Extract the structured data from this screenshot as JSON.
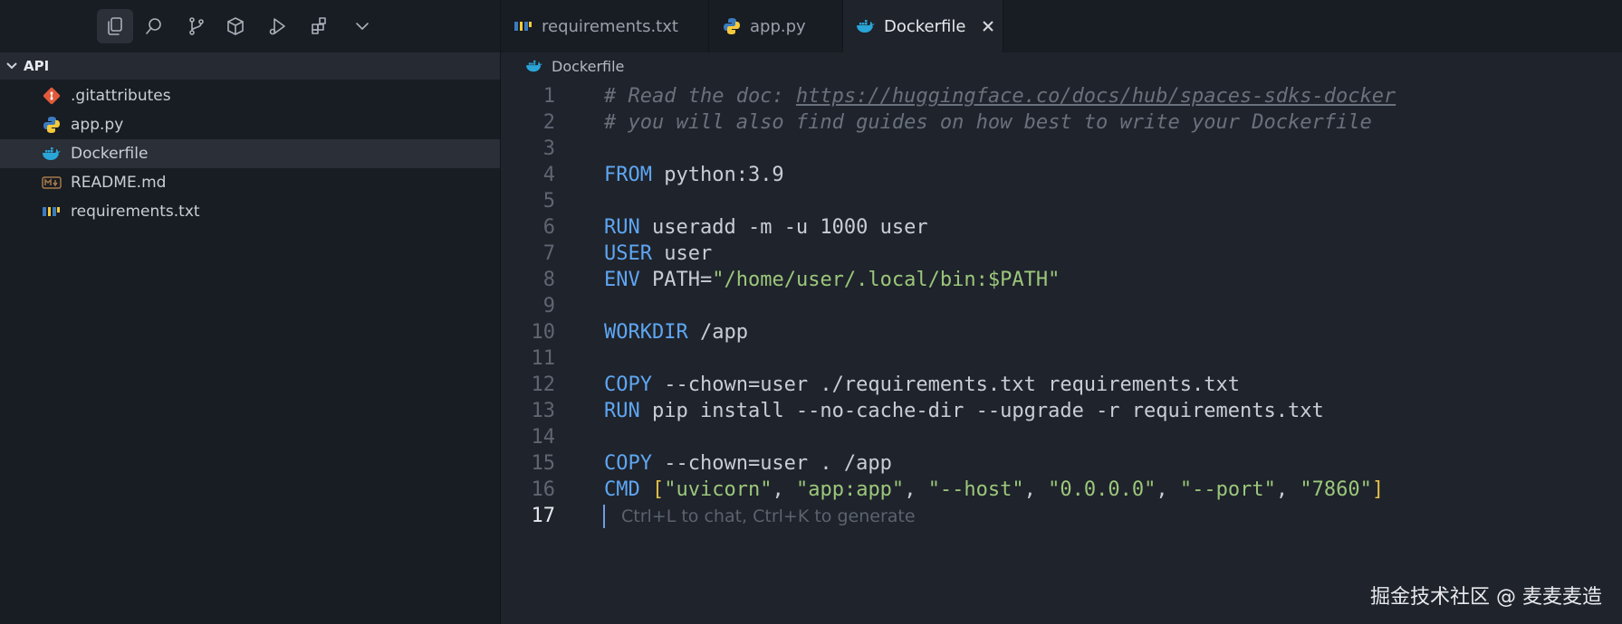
{
  "sidebar": {
    "folder": "API",
    "files": [
      {
        "name": ".gitattributes",
        "icon": "git-icon"
      },
      {
        "name": "app.py",
        "icon": "python-icon"
      },
      {
        "name": "Dockerfile",
        "icon": "docker-icon"
      },
      {
        "name": "README.md",
        "icon": "markdown-icon"
      },
      {
        "name": "requirements.txt",
        "icon": "pip-icon"
      }
    ]
  },
  "tabs": [
    {
      "label": "requirements.txt",
      "icon": "pip-icon"
    },
    {
      "label": "app.py",
      "icon": "python-icon"
    },
    {
      "label": "Dockerfile",
      "icon": "docker-icon"
    }
  ],
  "breadcrumb": "Dockerfile",
  "lines": [
    {
      "n": "1",
      "parts": [
        {
          "t": "# Read the doc: ",
          "c": "cm"
        },
        {
          "t": "https://huggingface.co/docs/hub/spaces-sdks-docker",
          "c": "cm url"
        }
      ]
    },
    {
      "n": "2",
      "parts": [
        {
          "t": "# you will also find guides on how best to write your Dockerfile",
          "c": "cm"
        }
      ]
    },
    {
      "n": "3",
      "parts": []
    },
    {
      "n": "4",
      "parts": [
        {
          "t": "FROM",
          "c": "kw"
        },
        {
          "t": " python:3.9",
          "c": "tx"
        }
      ]
    },
    {
      "n": "5",
      "parts": []
    },
    {
      "n": "6",
      "parts": [
        {
          "t": "RUN",
          "c": "kw"
        },
        {
          "t": " useradd -m -u 1000 user",
          "c": "tx"
        }
      ]
    },
    {
      "n": "7",
      "parts": [
        {
          "t": "USER",
          "c": "kw"
        },
        {
          "t": " user",
          "c": "tx"
        }
      ]
    },
    {
      "n": "8",
      "parts": [
        {
          "t": "ENV",
          "c": "kw"
        },
        {
          "t": " PATH=",
          "c": "tx"
        },
        {
          "t": "\"/home/user/.local/bin:$PATH\"",
          "c": "str"
        }
      ]
    },
    {
      "n": "9",
      "parts": []
    },
    {
      "n": "10",
      "parts": [
        {
          "t": "WORKDIR",
          "c": "kw"
        },
        {
          "t": " /app",
          "c": "tx"
        }
      ]
    },
    {
      "n": "11",
      "parts": []
    },
    {
      "n": "12",
      "parts": [
        {
          "t": "COPY",
          "c": "kw"
        },
        {
          "t": " --chown=user ./requirements.txt requirements.txt",
          "c": "tx"
        }
      ]
    },
    {
      "n": "13",
      "parts": [
        {
          "t": "RUN",
          "c": "kw"
        },
        {
          "t": " pip install --no-cache-dir --upgrade -r requirements.txt",
          "c": "tx"
        }
      ]
    },
    {
      "n": "14",
      "parts": []
    },
    {
      "n": "15",
      "parts": [
        {
          "t": "COPY",
          "c": "kw"
        },
        {
          "t": " --chown=user . /app",
          "c": "tx"
        }
      ]
    },
    {
      "n": "16",
      "parts": [
        {
          "t": "CMD",
          "c": "kw"
        },
        {
          "t": " ",
          "c": "tx"
        },
        {
          "t": "[",
          "c": "br"
        },
        {
          "t": "\"uvicorn\"",
          "c": "str"
        },
        {
          "t": ", ",
          "c": "tx"
        },
        {
          "t": "\"app:app\"",
          "c": "str"
        },
        {
          "t": ", ",
          "c": "tx"
        },
        {
          "t": "\"--host\"",
          "c": "str"
        },
        {
          "t": ", ",
          "c": "tx"
        },
        {
          "t": "\"0.0.0.0\"",
          "c": "str"
        },
        {
          "t": ", ",
          "c": "tx"
        },
        {
          "t": "\"--port\"",
          "c": "str"
        },
        {
          "t": ", ",
          "c": "tx"
        },
        {
          "t": "\"7860\"",
          "c": "str"
        },
        {
          "t": "]",
          "c": "br"
        }
      ]
    },
    {
      "n": "17",
      "parts": []
    }
  ],
  "hint": "Ctrl+L to chat, Ctrl+K to generate",
  "watermark": "掘金技术社区 @ 麦麦麦造",
  "colors": {
    "keyword": "#5ea6f2",
    "string": "#9bc77b",
    "comment": "#6a717c",
    "bracket": "#e2c04a"
  }
}
